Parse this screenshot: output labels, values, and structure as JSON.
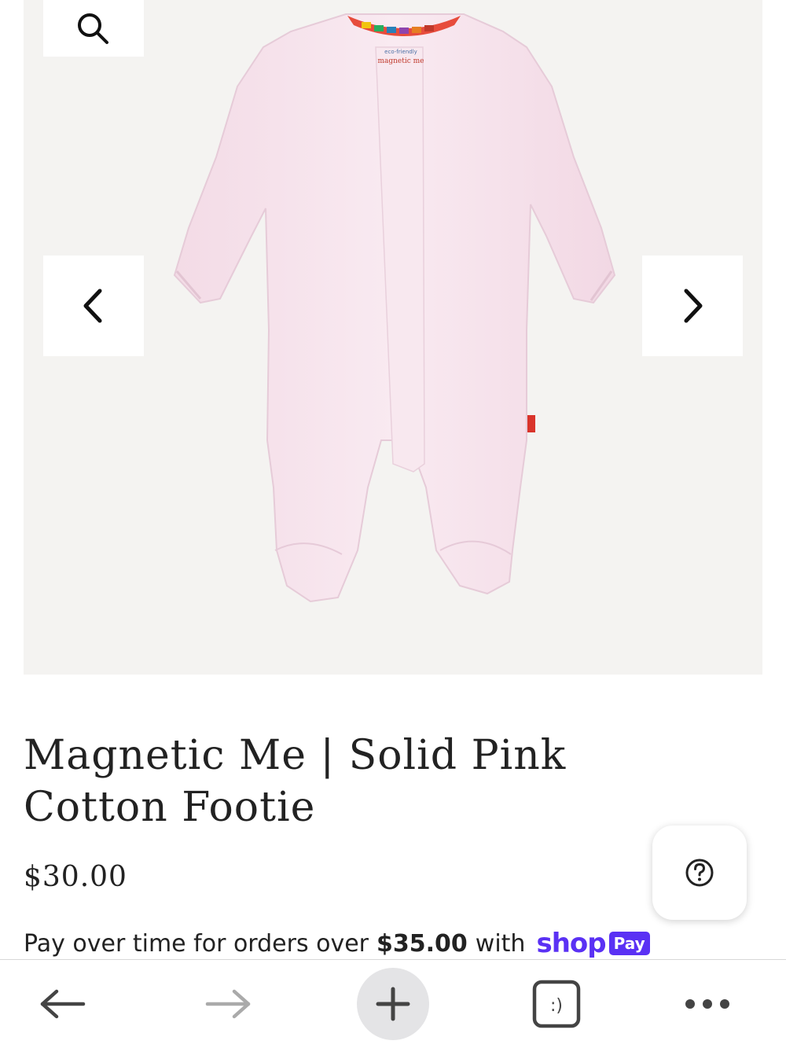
{
  "product": {
    "title": "Magnetic Me | Solid Pink Cotton Footie",
    "price": "$30.00",
    "image_label_brand": "magnetic me",
    "image_label_tag": "eco-friendly"
  },
  "payment": {
    "prefix": "Pay over time for orders over",
    "amount": "$35.00",
    "suffix": "with",
    "shop_word": "shop",
    "pay_badge": "Pay"
  },
  "tabs_button": {
    "label": ":)"
  },
  "icons": {
    "zoom": "search-icon",
    "prev": "chevron-left-icon",
    "next": "chevron-right-icon",
    "help": "question-circle-icon",
    "back": "arrow-left-icon",
    "forward": "arrow-right-icon",
    "new_tab": "plus-icon",
    "tabs": "tab-switcher-icon",
    "menu": "more-dots-icon"
  },
  "colors": {
    "shop_pay": "#5a31f4",
    "gallery_bg": "#f4f3f1",
    "garment": "#f7e6ee"
  }
}
